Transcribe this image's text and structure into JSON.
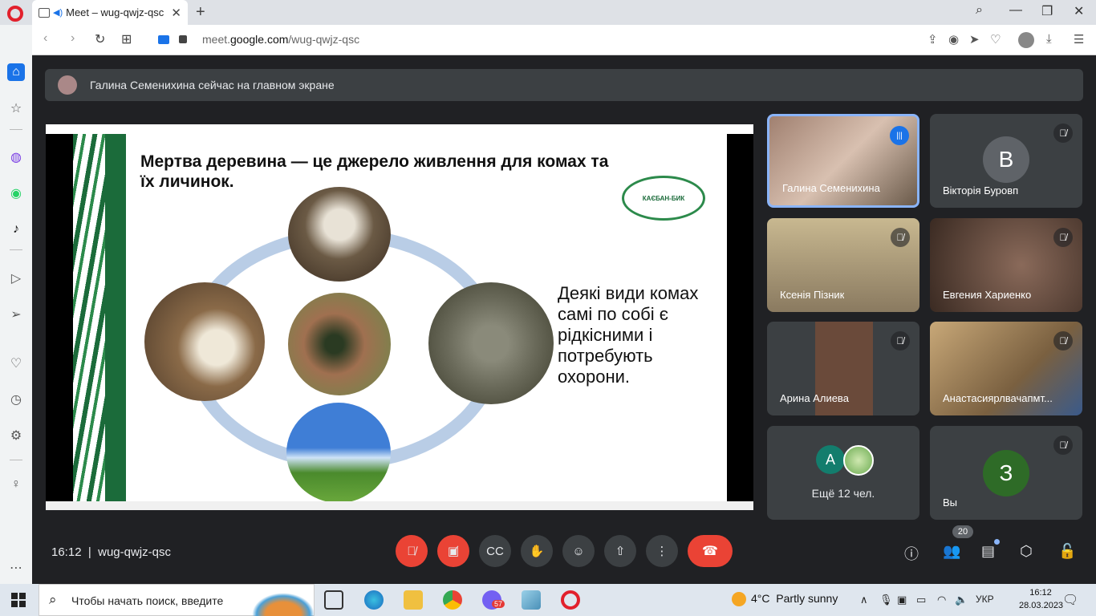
{
  "browser": {
    "tab_title": "Meet – wug-qwjz-qsc",
    "url_prefix": "meet.",
    "url_domain": "google.com",
    "url_path": "/wug-qwjz-qsc"
  },
  "meet": {
    "banner_text": "Галина Семенихина сейчас на главном экране",
    "meeting_code": "wug-qwjz-qsc",
    "time": "16:12",
    "participants_count": "20"
  },
  "slide": {
    "title": "Мертва деревина — це джерело живлення для комах та їх личинок.",
    "body": "Деякі види комах самі по собі є рідкісними і потребують охорони.",
    "logo_text": "КАЄБАН-БИК"
  },
  "tiles": [
    {
      "name": "Галина Семенихина",
      "speaking": true
    },
    {
      "name": "Вікторія Буровп",
      "letter": "В",
      "color": "#5f6368"
    },
    {
      "name": "Ксенія Пізник"
    },
    {
      "name": "Евгения Хариенко"
    },
    {
      "name": "Арина Алиева"
    },
    {
      "name": "Анастасиярлвачапмт..."
    },
    {
      "more_label": "Ещё 12 чел.",
      "letter": "А"
    },
    {
      "name": "Вы",
      "letter": "З",
      "color": "#2e6b27"
    }
  ],
  "taskbar": {
    "search_placeholder": "Чтобы начать поиск, введите",
    "weather_temp": "4°C",
    "weather_text": "Partly sunny",
    "lang": "УКР",
    "clock_time": "16:12",
    "clock_date": "28.03.2023",
    "viber_badge": "57"
  }
}
